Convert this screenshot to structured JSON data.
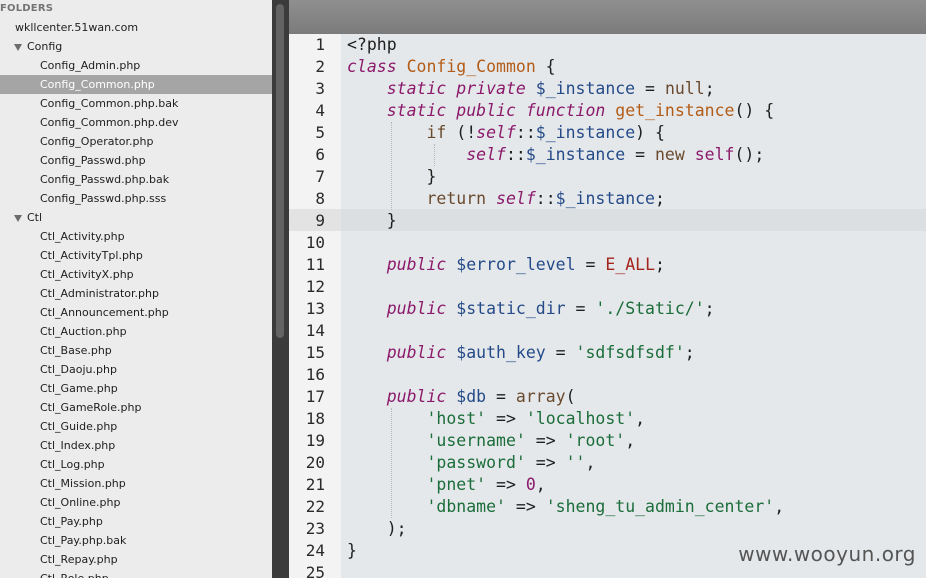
{
  "sidebar": {
    "header": "FOLDERS",
    "items": [
      {
        "label": "wkllcenter.51wan.com",
        "level": 0,
        "type": "folder",
        "expanded": null
      },
      {
        "label": "Config",
        "level": 1,
        "type": "folder",
        "expanded": true
      },
      {
        "label": "Config_Admin.php",
        "level": 2,
        "type": "file"
      },
      {
        "label": "Config_Common.php",
        "level": 2,
        "type": "file",
        "selected": true
      },
      {
        "label": "Config_Common.php.bak",
        "level": 2,
        "type": "file"
      },
      {
        "label": "Config_Common.php.dev",
        "level": 2,
        "type": "file"
      },
      {
        "label": "Config_Operator.php",
        "level": 2,
        "type": "file"
      },
      {
        "label": "Config_Passwd.php",
        "level": 2,
        "type": "file"
      },
      {
        "label": "Config_Passwd.php.bak",
        "level": 2,
        "type": "file"
      },
      {
        "label": "Config_Passwd.php.sss",
        "level": 2,
        "type": "file"
      },
      {
        "label": "Ctl",
        "level": 1,
        "type": "folder",
        "expanded": true
      },
      {
        "label": "Ctl_Activity.php",
        "level": 2,
        "type": "file"
      },
      {
        "label": "Ctl_ActivityTpl.php",
        "level": 2,
        "type": "file"
      },
      {
        "label": "Ctl_ActivityX.php",
        "level": 2,
        "type": "file"
      },
      {
        "label": "Ctl_Administrator.php",
        "level": 2,
        "type": "file"
      },
      {
        "label": "Ctl_Announcement.php",
        "level": 2,
        "type": "file"
      },
      {
        "label": "Ctl_Auction.php",
        "level": 2,
        "type": "file"
      },
      {
        "label": "Ctl_Base.php",
        "level": 2,
        "type": "file"
      },
      {
        "label": "Ctl_Daoju.php",
        "level": 2,
        "type": "file"
      },
      {
        "label": "Ctl_Game.php",
        "level": 2,
        "type": "file"
      },
      {
        "label": "Ctl_GameRole.php",
        "level": 2,
        "type": "file"
      },
      {
        "label": "Ctl_Guide.php",
        "level": 2,
        "type": "file"
      },
      {
        "label": "Ctl_Index.php",
        "level": 2,
        "type": "file"
      },
      {
        "label": "Ctl_Log.php",
        "level": 2,
        "type": "file"
      },
      {
        "label": "Ctl_Mission.php",
        "level": 2,
        "type": "file"
      },
      {
        "label": "Ctl_Online.php",
        "level": 2,
        "type": "file"
      },
      {
        "label": "Ctl_Pay.php",
        "level": 2,
        "type": "file"
      },
      {
        "label": "Ctl_Pay.php.bak",
        "level": 2,
        "type": "file"
      },
      {
        "label": "Ctl_Repay.php",
        "level": 2,
        "type": "file"
      },
      {
        "label": "Ctl_Role.php",
        "level": 2,
        "type": "file"
      }
    ]
  },
  "editor": {
    "active_line": 9,
    "lines": [
      {
        "n": "1",
        "tokens": [
          [
            "plain",
            "<?php"
          ]
        ]
      },
      {
        "n": "2",
        "tokens": [
          [
            "kw",
            "class"
          ],
          [
            "plain",
            " "
          ],
          [
            "cls",
            "Config_Common"
          ],
          [
            "plain",
            " {"
          ]
        ]
      },
      {
        "n": "3",
        "tokens": [
          [
            "plain",
            "    "
          ],
          [
            "kw",
            "static"
          ],
          [
            "plain",
            " "
          ],
          [
            "kw",
            "private"
          ],
          [
            "plain",
            " "
          ],
          [
            "var",
            "$_instance"
          ],
          [
            "plain",
            " = "
          ],
          [
            "kwp",
            "null"
          ],
          [
            "plain",
            ";"
          ]
        ]
      },
      {
        "n": "4",
        "tokens": [
          [
            "plain",
            "    "
          ],
          [
            "kw",
            "static"
          ],
          [
            "plain",
            " "
          ],
          [
            "kw",
            "public"
          ],
          [
            "plain",
            " "
          ],
          [
            "kw",
            "function"
          ],
          [
            "plain",
            " "
          ],
          [
            "fn",
            "get_instance"
          ],
          [
            "plain",
            "() {"
          ]
        ]
      },
      {
        "n": "5",
        "tokens": [
          [
            "plain",
            "        "
          ],
          [
            "kwp",
            "if"
          ],
          [
            "plain",
            " (!"
          ],
          [
            "self",
            "self"
          ],
          [
            "plain",
            "::"
          ],
          [
            "var",
            "$_instance"
          ],
          [
            "plain",
            ") {"
          ]
        ]
      },
      {
        "n": "6",
        "tokens": [
          [
            "plain",
            "            "
          ],
          [
            "self",
            "self"
          ],
          [
            "plain",
            "::"
          ],
          [
            "var",
            "$_instance"
          ],
          [
            "plain",
            " = "
          ],
          [
            "kwp",
            "new"
          ],
          [
            "plain",
            " "
          ],
          [
            "selfp",
            "self"
          ],
          [
            "plain",
            "();"
          ]
        ]
      },
      {
        "n": "7",
        "tokens": [
          [
            "plain",
            "        }"
          ]
        ]
      },
      {
        "n": "8",
        "tokens": [
          [
            "plain",
            "        "
          ],
          [
            "kwp",
            "return"
          ],
          [
            "plain",
            " "
          ],
          [
            "self",
            "self"
          ],
          [
            "plain",
            "::"
          ],
          [
            "var",
            "$_instance"
          ],
          [
            "plain",
            ";"
          ]
        ]
      },
      {
        "n": "9",
        "tokens": [
          [
            "plain",
            "    }"
          ]
        ]
      },
      {
        "n": "10",
        "tokens": []
      },
      {
        "n": "11",
        "tokens": [
          [
            "plain",
            "    "
          ],
          [
            "kw",
            "public"
          ],
          [
            "plain",
            " "
          ],
          [
            "var",
            "$error_level"
          ],
          [
            "plain",
            " = "
          ],
          [
            "const",
            "E_ALL"
          ],
          [
            "plain",
            ";"
          ]
        ]
      },
      {
        "n": "12",
        "tokens": []
      },
      {
        "n": "13",
        "tokens": [
          [
            "plain",
            "    "
          ],
          [
            "kw",
            "public"
          ],
          [
            "plain",
            " "
          ],
          [
            "var",
            "$static_dir"
          ],
          [
            "plain",
            " = "
          ],
          [
            "str",
            "'./Static/'"
          ],
          [
            "plain",
            ";"
          ]
        ]
      },
      {
        "n": "14",
        "tokens": []
      },
      {
        "n": "15",
        "tokens": [
          [
            "plain",
            "    "
          ],
          [
            "kw",
            "public"
          ],
          [
            "plain",
            " "
          ],
          [
            "var",
            "$auth_key"
          ],
          [
            "plain",
            " = "
          ],
          [
            "str",
            "'sdfsdfsdf'"
          ],
          [
            "plain",
            ";"
          ]
        ]
      },
      {
        "n": "16",
        "tokens": []
      },
      {
        "n": "17",
        "tokens": [
          [
            "plain",
            "    "
          ],
          [
            "kw",
            "public"
          ],
          [
            "plain",
            " "
          ],
          [
            "var",
            "$db"
          ],
          [
            "plain",
            " = "
          ],
          [
            "kwp",
            "array"
          ],
          [
            "plain",
            "("
          ]
        ]
      },
      {
        "n": "18",
        "tokens": [
          [
            "plain",
            "        "
          ],
          [
            "str",
            "'host'"
          ],
          [
            "plain",
            " => "
          ],
          [
            "str",
            "'localhost'"
          ],
          [
            "plain",
            ","
          ]
        ]
      },
      {
        "n": "19",
        "tokens": [
          [
            "plain",
            "        "
          ],
          [
            "str",
            "'username'"
          ],
          [
            "plain",
            " => "
          ],
          [
            "str",
            "'root'"
          ],
          [
            "plain",
            ","
          ]
        ]
      },
      {
        "n": "20",
        "tokens": [
          [
            "plain",
            "        "
          ],
          [
            "str",
            "'password'"
          ],
          [
            "plain",
            " => "
          ],
          [
            "str",
            "''"
          ],
          [
            "plain",
            ","
          ]
        ]
      },
      {
        "n": "21",
        "tokens": [
          [
            "plain",
            "        "
          ],
          [
            "str",
            "'pnet'"
          ],
          [
            "plain",
            " => "
          ],
          [
            "num",
            "0"
          ],
          [
            "plain",
            ","
          ]
        ]
      },
      {
        "n": "22",
        "tokens": [
          [
            "plain",
            "        "
          ],
          [
            "str",
            "'dbname'"
          ],
          [
            "plain",
            " => "
          ],
          [
            "str",
            "'sheng_tu_admin_center'"
          ],
          [
            "plain",
            ","
          ]
        ]
      },
      {
        "n": "23",
        "tokens": [
          [
            "plain",
            "    );"
          ]
        ]
      },
      {
        "n": "24",
        "tokens": [
          [
            "plain",
            "}"
          ]
        ]
      },
      {
        "n": "25",
        "tokens": []
      }
    ]
  },
  "watermark": "www.wooyun.org"
}
